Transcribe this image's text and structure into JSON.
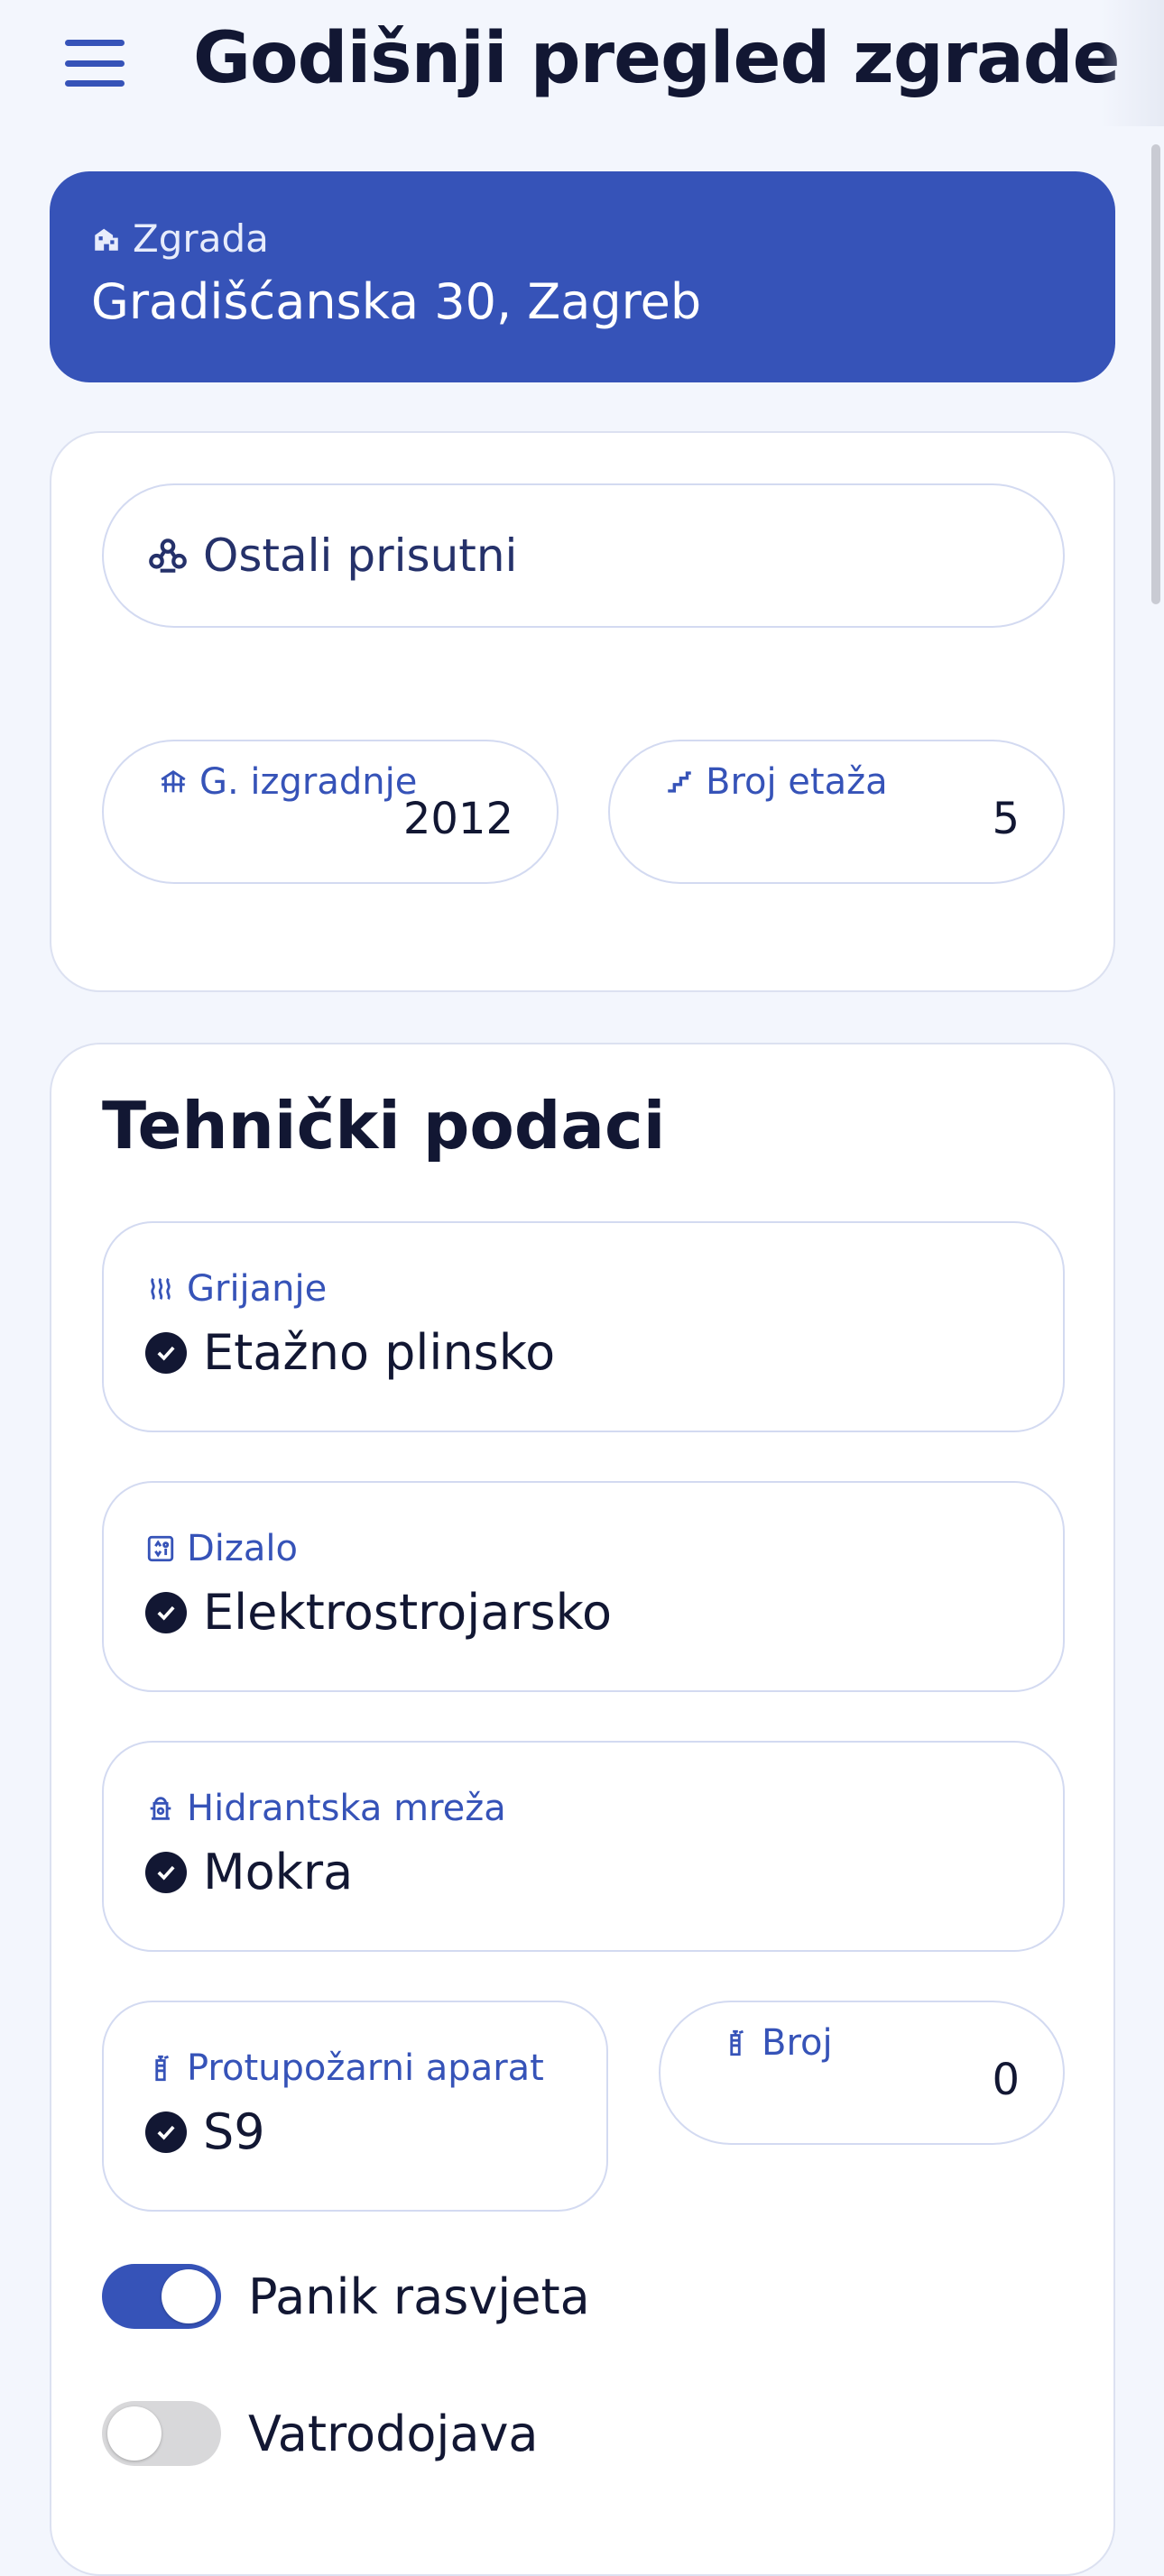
{
  "header": {
    "title": "Godišnji pregled zgrade",
    "menu_icon": "hamburger-menu-icon"
  },
  "building": {
    "label": "Zgrada",
    "value": "Gradišćanska 30, Zagreb",
    "icon": "building-icon"
  },
  "general": {
    "others_label": "Ostali prisutni",
    "others_icon": "group-icon",
    "year_label": "G. izgradnje",
    "year_value": "2012",
    "year_icon": "construction-icon",
    "floors_label": "Broj etaža",
    "floors_value": "5",
    "floors_icon": "stairs-icon"
  },
  "technical": {
    "title": "Tehnički podaci",
    "heating": {
      "label": "Grijanje",
      "value": "Etažno plinsko",
      "icon": "heat-icon"
    },
    "elevator": {
      "label": "Dizalo",
      "value": "Elektrostrojarsko",
      "icon": "elevator-icon"
    },
    "hydrant": {
      "label": "Hidrantska mreža",
      "value": "Mokra",
      "icon": "hydrant-icon"
    },
    "extinguisher": {
      "label": "Protupožarni aparat",
      "value": "S9",
      "icon": "fire-extinguisher-icon"
    },
    "count": {
      "label": "Broj",
      "value": "0",
      "icon": "fire-extinguisher-icon"
    },
    "panic_light": {
      "label": "Panik rasvjeta",
      "on": true
    },
    "fire_alarm": {
      "label": "Vatrodojava",
      "on": false
    }
  },
  "colors": {
    "primary": "#3653B8",
    "text": "#121733",
    "background": "#F3F6FD",
    "border": "#D3DAF1"
  }
}
